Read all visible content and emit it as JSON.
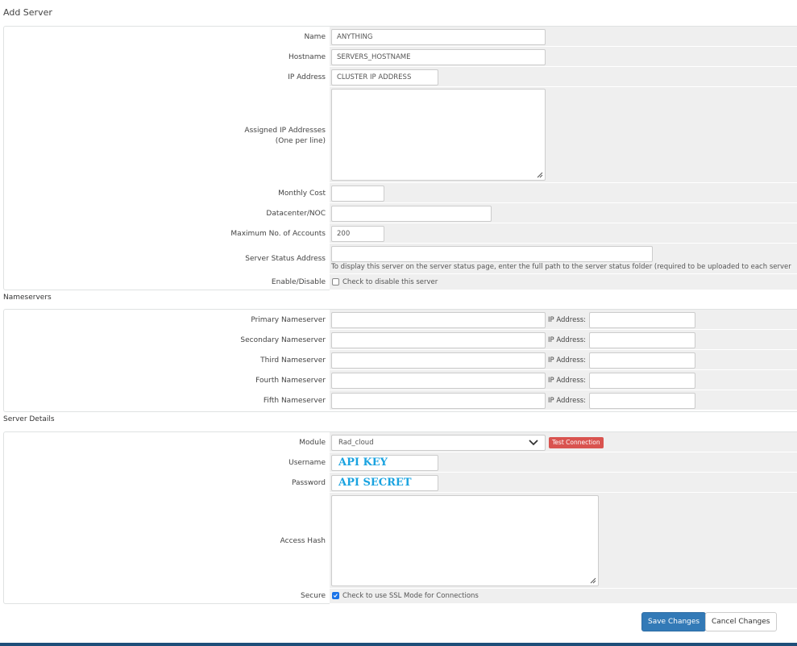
{
  "page": {
    "title": "Add Server"
  },
  "server": {
    "name": {
      "label": "Name",
      "value": "ANYTHING"
    },
    "hostname": {
      "label": "Hostname",
      "value": "SERVERS_HOSTNAME"
    },
    "ip_address": {
      "label": "IP Address",
      "value": "CLUSTER IP ADDRESS"
    },
    "assigned_ips": {
      "label": "Assigned IP Addresses",
      "sublabel": "(One per line)",
      "value": ""
    },
    "monthly_cost": {
      "label": "Monthly Cost",
      "value": ""
    },
    "datacenter": {
      "label": "Datacenter/NOC",
      "value": ""
    },
    "max_accounts": {
      "label": "Maximum No. of Accounts",
      "value": "200"
    },
    "status_address": {
      "label": "Server Status Address",
      "value": "",
      "help": "To display this server on the server status page, enter the full path to the server status folder (required to be uploaded to each server"
    },
    "enable_disable": {
      "label": "Enable/Disable",
      "checkbox_label": "Check to disable this server",
      "checked": false
    }
  },
  "nameservers": {
    "title": "Nameservers",
    "ip_label": "IP Address:",
    "items": [
      {
        "label": "Primary Nameserver",
        "value": "",
        "ip": ""
      },
      {
        "label": "Secondary Nameserver",
        "value": "",
        "ip": ""
      },
      {
        "label": "Third Nameserver",
        "value": "",
        "ip": ""
      },
      {
        "label": "Fourth Nameserver",
        "value": "",
        "ip": ""
      },
      {
        "label": "Fifth Nameserver",
        "value": "",
        "ip": ""
      }
    ]
  },
  "details": {
    "title": "Server Details",
    "module": {
      "label": "Module",
      "value": "Rad_cloud",
      "test_button": "Test Connection"
    },
    "username": {
      "label": "Username",
      "value": "API KEY"
    },
    "password": {
      "label": "Password",
      "value": "API SECRET"
    },
    "access_hash": {
      "label": "Access Hash",
      "value": ""
    },
    "secure": {
      "label": "Secure",
      "checkbox_label": "Check to use SSL Mode for Connections",
      "checked": true
    }
  },
  "actions": {
    "save": "Save Changes",
    "cancel": "Cancel Changes"
  },
  "colors": {
    "primary": "#337ab7",
    "danger": "#d9534f",
    "field_bg": "#efefef",
    "footer": "#1e4e79"
  }
}
